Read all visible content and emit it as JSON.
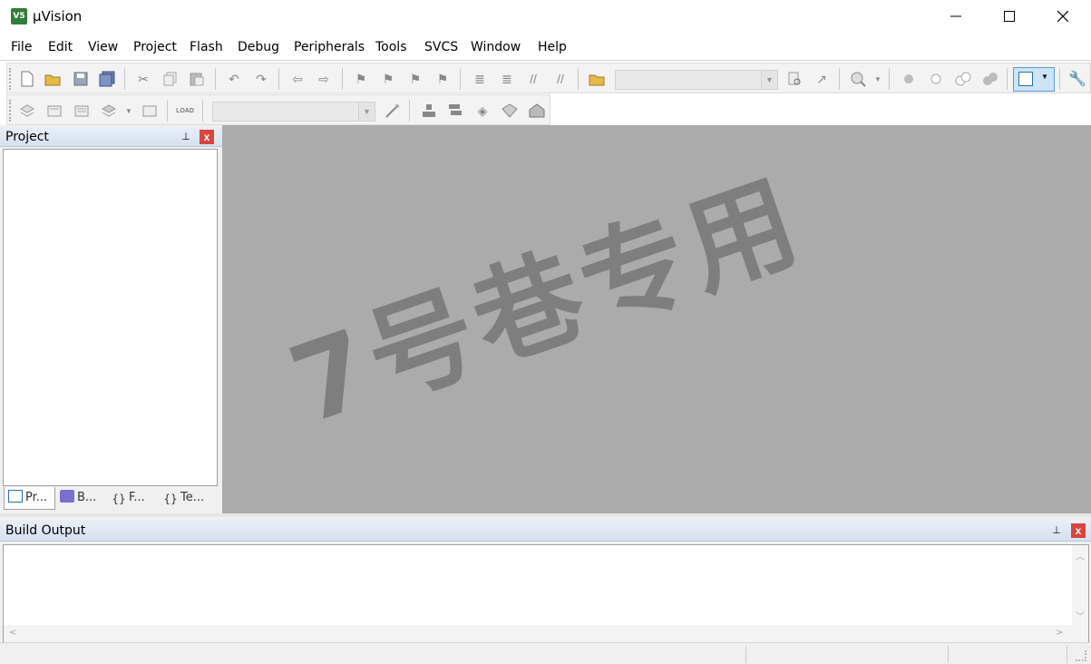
{
  "window": {
    "title": "µVision",
    "app_icon_text": "V5",
    "accent_color": "#2f7d3a"
  },
  "menu": {
    "items": [
      "File",
      "Edit",
      "View",
      "Project",
      "Flash",
      "Debug",
      "Peripherals",
      "Tools",
      "SVCS",
      "Window",
      "Help"
    ]
  },
  "toolbar1": {
    "icons": [
      "new-file-icon",
      "open-folder-icon",
      "save-icon",
      "save-all-icon",
      "cut-icon",
      "copy-icon",
      "paste-icon",
      "undo-icon",
      "redo-icon",
      "nav-back-icon",
      "nav-forward-icon",
      "bookmark-icon",
      "bookmark-prev-icon",
      "bookmark-next-icon",
      "bookmark-clear-icon",
      "indent-icon",
      "unindent-icon",
      "comment-icon",
      "uncomment-icon",
      "find-in-files-icon",
      "find-icon",
      "incremental-find-icon",
      "debug-session-icon",
      "breakpoint-icon",
      "breakpoint-disable-icon",
      "breakpoint-disable-all-icon",
      "breakpoint-kill-all-icon",
      "window-layout-icon",
      "configure-icon"
    ]
  },
  "toolbar2": {
    "icons": [
      "translate-icon",
      "build-icon",
      "rebuild-icon",
      "batch-build-icon",
      "stop-build-icon",
      "download-icon",
      "target-options-icon",
      "manage-components-icon",
      "manage-project-items-icon",
      "select-packs-icon",
      "manage-run-time-icon"
    ]
  },
  "project_panel": {
    "title": "Project",
    "pin": "⊥",
    "close": "x",
    "tabs": [
      "Pr...",
      "B...",
      "F...",
      "Te..."
    ]
  },
  "editor": {
    "watermark": "7号巷专用",
    "background": "#ababab"
  },
  "build_output": {
    "title": "Build Output",
    "pin": "⊥",
    "close": "x"
  }
}
